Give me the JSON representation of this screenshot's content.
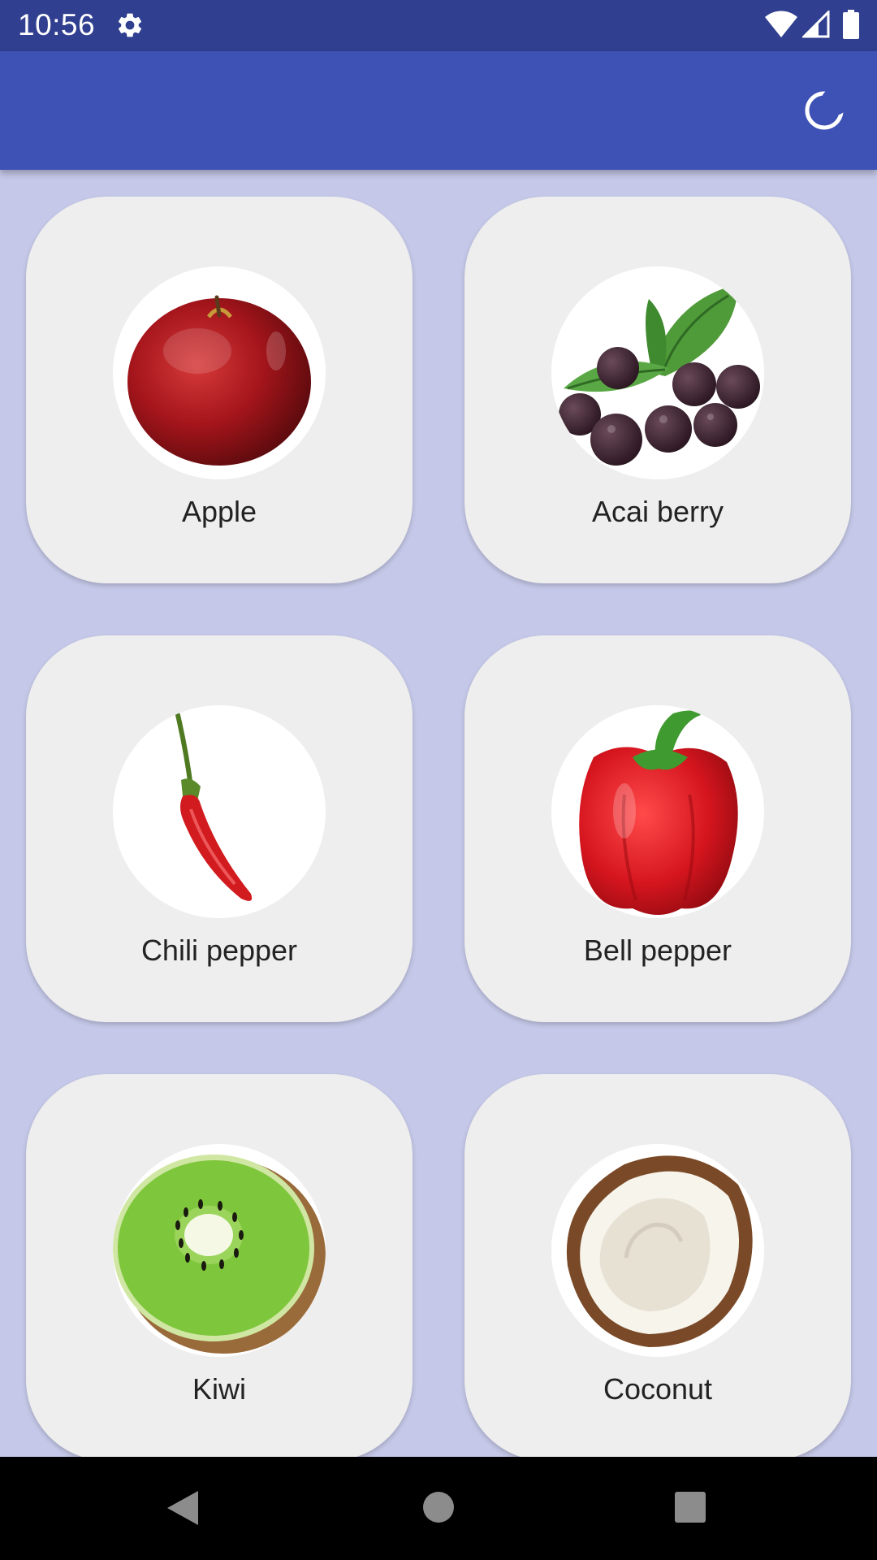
{
  "status_bar": {
    "time": "10:56",
    "icons": [
      "gear-icon",
      "wifi-icon",
      "cell-signal-icon",
      "battery-icon"
    ]
  },
  "app_bar": {
    "action_icon": "moon-icon"
  },
  "colors": {
    "status_bar": "#303f8f",
    "app_bar": "#3e51b5",
    "background": "#c5c8e8",
    "card": "#eeeeee"
  },
  "items": [
    {
      "label": "Apple",
      "icon": "apple-image"
    },
    {
      "label": "Acai berry",
      "icon": "acai-berry-image"
    },
    {
      "label": "Chili pepper",
      "icon": "chili-pepper-image"
    },
    {
      "label": "Bell pepper",
      "icon": "bell-pepper-image"
    },
    {
      "label": "Kiwi",
      "icon": "kiwi-image"
    },
    {
      "label": "Coconut",
      "icon": "coconut-image"
    }
  ],
  "navigation": {
    "icons": [
      "back-icon",
      "home-icon",
      "recents-icon"
    ]
  }
}
